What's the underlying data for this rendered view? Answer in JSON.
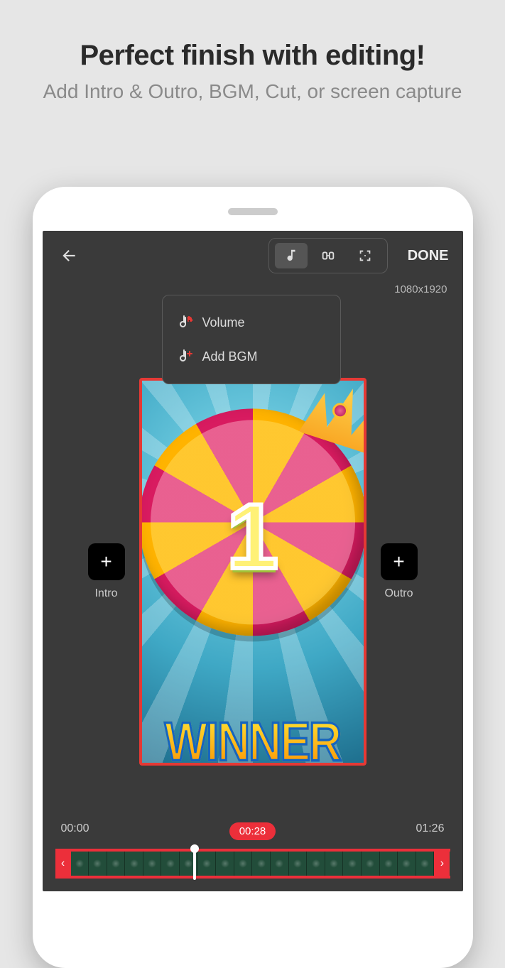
{
  "promo": {
    "title": "Perfect finish with editing!",
    "subtitle": "Add Intro & Outro, BGM, Cut, or screen capture"
  },
  "toolbar": {
    "done_label": "DONE",
    "resolution": "1080x1920"
  },
  "dropdown": {
    "volume_label": "Volume",
    "add_bgm_label": "Add BGM"
  },
  "sides": {
    "intro_label": "Intro",
    "outro_label": "Outro"
  },
  "preview": {
    "number": "1",
    "banner": "WINNER"
  },
  "timeline": {
    "start": "00:00",
    "current": "00:28",
    "end": "01:26"
  }
}
